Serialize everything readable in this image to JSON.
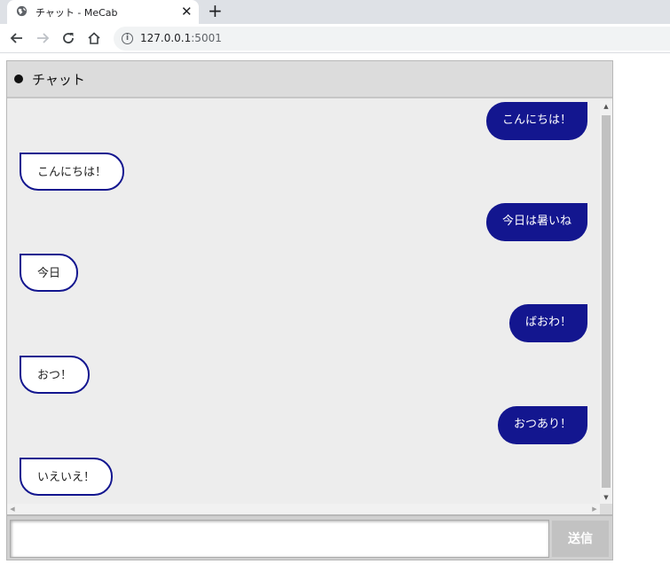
{
  "browser": {
    "tab_title": "チャット - MeCab",
    "close_glyph": "✕",
    "new_tab_glyph": "+",
    "url_host": "127.0.0.1",
    "url_port": ":5001",
    "info_glyph": "i"
  },
  "chat": {
    "title": "チャット",
    "messages": [
      {
        "from": "me",
        "text": "こんにちは！"
      },
      {
        "from": "bot",
        "text": "こんにちは！"
      },
      {
        "from": "me",
        "text": "今日は暑いね"
      },
      {
        "from": "bot",
        "text": "今日"
      },
      {
        "from": "me",
        "text": "ばおわ！"
      },
      {
        "from": "bot",
        "text": "おつ！"
      },
      {
        "from": "me",
        "text": "おつあり！"
      },
      {
        "from": "bot",
        "text": "いえいえ！"
      }
    ],
    "input_value": "",
    "send_label": "送信",
    "scroll_up_glyph": "▲",
    "scroll_down_glyph": "▼",
    "scroll_left_glyph": "◀",
    "scroll_right_glyph": "▶"
  },
  "colors": {
    "user_bubble": "#13168f",
    "header_bg": "#dcdcdc",
    "chat_bg": "#ededed"
  }
}
